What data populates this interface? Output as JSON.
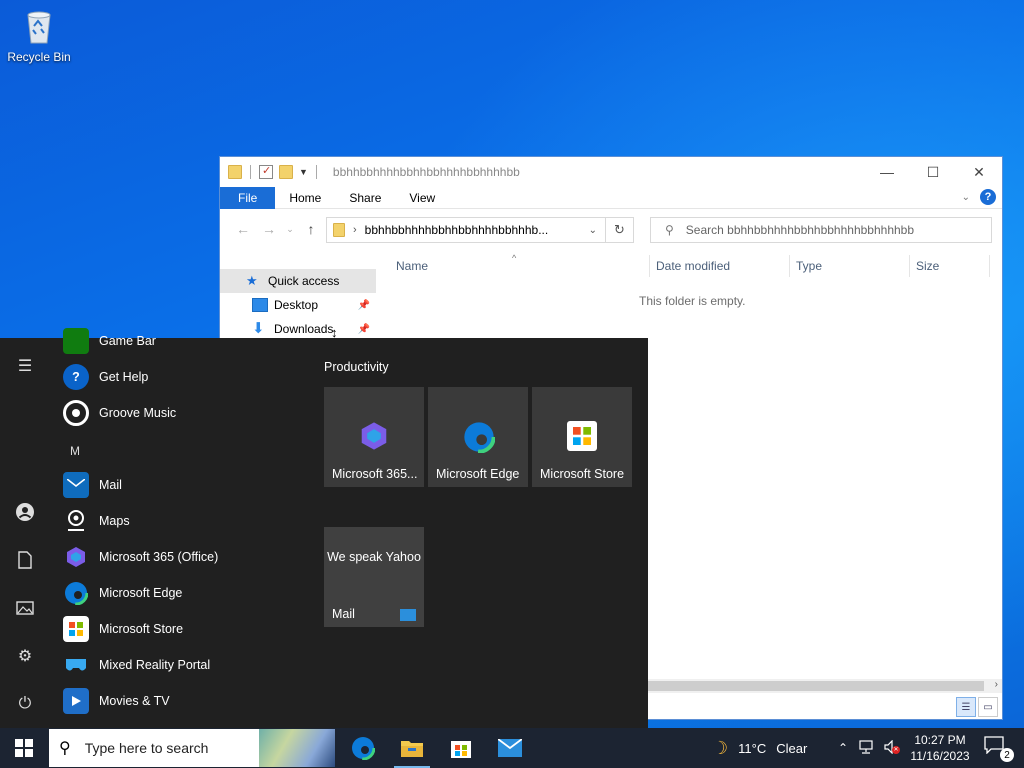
{
  "desktop": {
    "icons": [
      {
        "label": "Recycle Bin",
        "icon": "recycle-bin-icon"
      }
    ]
  },
  "explorer": {
    "title": "bbhhbbhhhhbbhhbbhhhhbbhhhhbb",
    "controls": {
      "minimize": "—",
      "maximize": "☐",
      "close": "✕"
    },
    "ribbon_tabs": [
      "File",
      "Home",
      "Share",
      "View"
    ],
    "address": "bbhhbbhhhhbbhhbbhhhhbbhhhb...",
    "search_placeholder": "Search bbhhbbhhhhbbhhbbhhhhbbhhhhbb",
    "nav": [
      {
        "label": "Quick access",
        "icon": "star-icon"
      },
      {
        "label": "Desktop",
        "icon": "desktop-folder-icon"
      },
      {
        "label": "Downloads",
        "icon": "download-arrow-icon"
      }
    ],
    "columns": [
      "Name",
      "Date modified",
      "Type",
      "Size"
    ],
    "empty_message": "This folder is empty."
  },
  "start_menu": {
    "apps": [
      {
        "label": "Game Bar",
        "icon": "game-bar-icon"
      },
      {
        "label": "Get Help",
        "icon": "get-help-icon"
      },
      {
        "label": "Groove Music",
        "icon": "groove-music-icon"
      },
      {
        "letter": "M"
      },
      {
        "label": "Mail",
        "icon": "mail-icon"
      },
      {
        "label": "Maps",
        "icon": "maps-icon"
      },
      {
        "label": "Microsoft 365 (Office)",
        "icon": "office-icon"
      },
      {
        "label": "Microsoft Edge",
        "icon": "edge-icon"
      },
      {
        "label": "Microsoft Store",
        "icon": "store-icon"
      },
      {
        "label": "Mixed Reality Portal",
        "icon": "mixed-reality-icon"
      },
      {
        "label": "Movies & TV",
        "icon": "movies-tv-icon"
      }
    ],
    "group_title": "Productivity",
    "tiles": [
      {
        "label": "Microsoft 365...",
        "icon": "office-icon"
      },
      {
        "label": "Microsoft Edge",
        "icon": "edge-icon"
      },
      {
        "label": "Microsoft Store",
        "icon": "store-icon"
      },
      {
        "label": "Mail",
        "text": "We speak Yahoo",
        "icon": "mail-icon"
      }
    ]
  },
  "taskbar": {
    "search_placeholder": "Type here to search",
    "weather": {
      "temp": "11°C",
      "condition": "Clear"
    },
    "clock": {
      "time": "10:27 PM",
      "date": "11/16/2023"
    },
    "notification_count": "2"
  }
}
